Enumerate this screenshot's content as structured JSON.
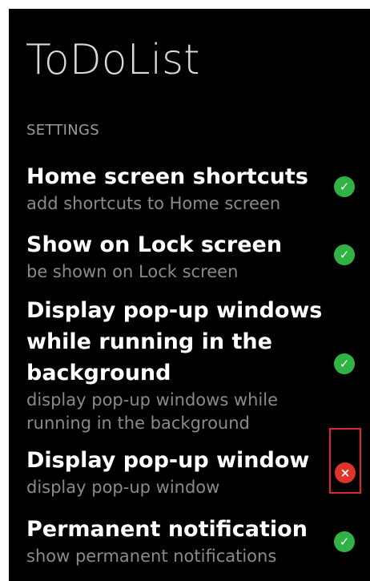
{
  "app": {
    "title": "ToDoList"
  },
  "settings": {
    "section_header": "SETTINGS",
    "items": [
      {
        "title": "Home screen shortcuts",
        "subtitle": "add shortcuts to Home screen",
        "status": "enabled",
        "status_icon": "check-icon",
        "status_glyph": "✓"
      },
      {
        "title": "Show on Lock screen",
        "subtitle": "be shown on Lock screen",
        "status": "enabled",
        "status_icon": "check-icon",
        "status_glyph": "✓"
      },
      {
        "title": "Display pop-up windows while running in the background",
        "subtitle": "display pop-up windows while running in the background",
        "status": "enabled",
        "status_icon": "check-icon",
        "status_glyph": "✓"
      },
      {
        "title": "Display pop-up window",
        "subtitle": "display pop-up window",
        "status": "disabled",
        "status_icon": "close-icon",
        "status_glyph": "×"
      },
      {
        "title": "Permanent notification",
        "subtitle": "show permanent notifications",
        "status": "enabled",
        "status_icon": "check-icon",
        "status_glyph": "✓"
      }
    ]
  },
  "colors": {
    "background": "#000000",
    "enabled": "#2fb344",
    "disabled": "#e0342b",
    "highlight": "#e3262b"
  }
}
